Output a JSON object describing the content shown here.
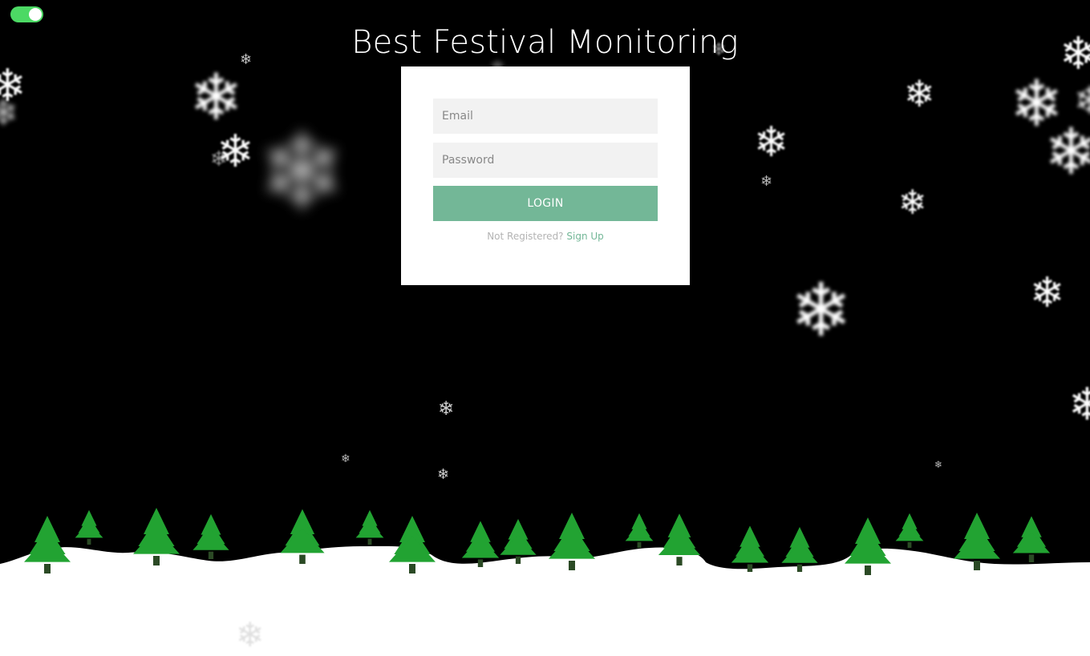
{
  "page": {
    "title": "Best Festival Monitoring"
  },
  "theme_toggle": {
    "state": "on",
    "color": "#4cd964"
  },
  "login_form": {
    "email_placeholder": "Email",
    "email_value": "",
    "password_placeholder": "Password",
    "password_value": "",
    "login_label": "LOGIN",
    "not_registered_text": "Not Registered?",
    "signup_label": "Sign Up"
  },
  "colors": {
    "background": "#000000",
    "accent": "#73b797",
    "tree": "#22a332",
    "trunk": "#2b4a25",
    "snow": "#ffffff"
  },
  "decorations": {
    "snowflake_icon": "snowflake-icon",
    "tree_icon": "pine-tree-icon"
  }
}
